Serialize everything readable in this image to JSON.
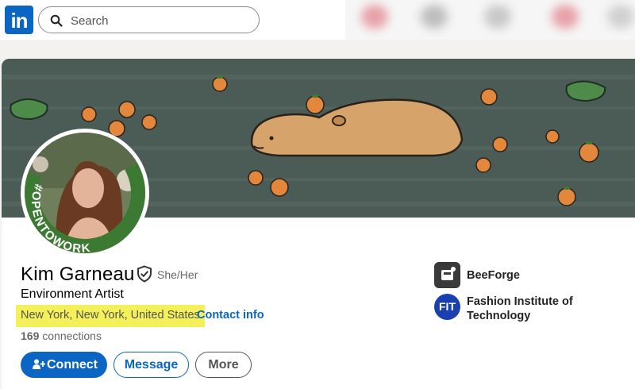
{
  "nav": {
    "logo_text": "in",
    "search_placeholder": "Search"
  },
  "profile": {
    "name": "Kim Garneau",
    "pronouns": "She/Her",
    "headline": "Environment Artist",
    "location": "New York, New York, United States",
    "separator": "·",
    "contact_label": "Contact info",
    "connections_count": "169",
    "connections_label": "connections",
    "open_to_work_badge": "#OPENTOWORK",
    "actions": {
      "connect": "Connect",
      "message": "Message",
      "more": "More"
    }
  },
  "organizations": [
    {
      "name": "BeeForge",
      "logo_text": ""
    },
    {
      "name": "Fashion Institute of Technology",
      "logo_text": "FIT"
    }
  ],
  "colors": {
    "brand_blue": "#0a66c2",
    "open_to_work_green": "#3c7a33",
    "highlight_yellow": "#f3f05a"
  }
}
